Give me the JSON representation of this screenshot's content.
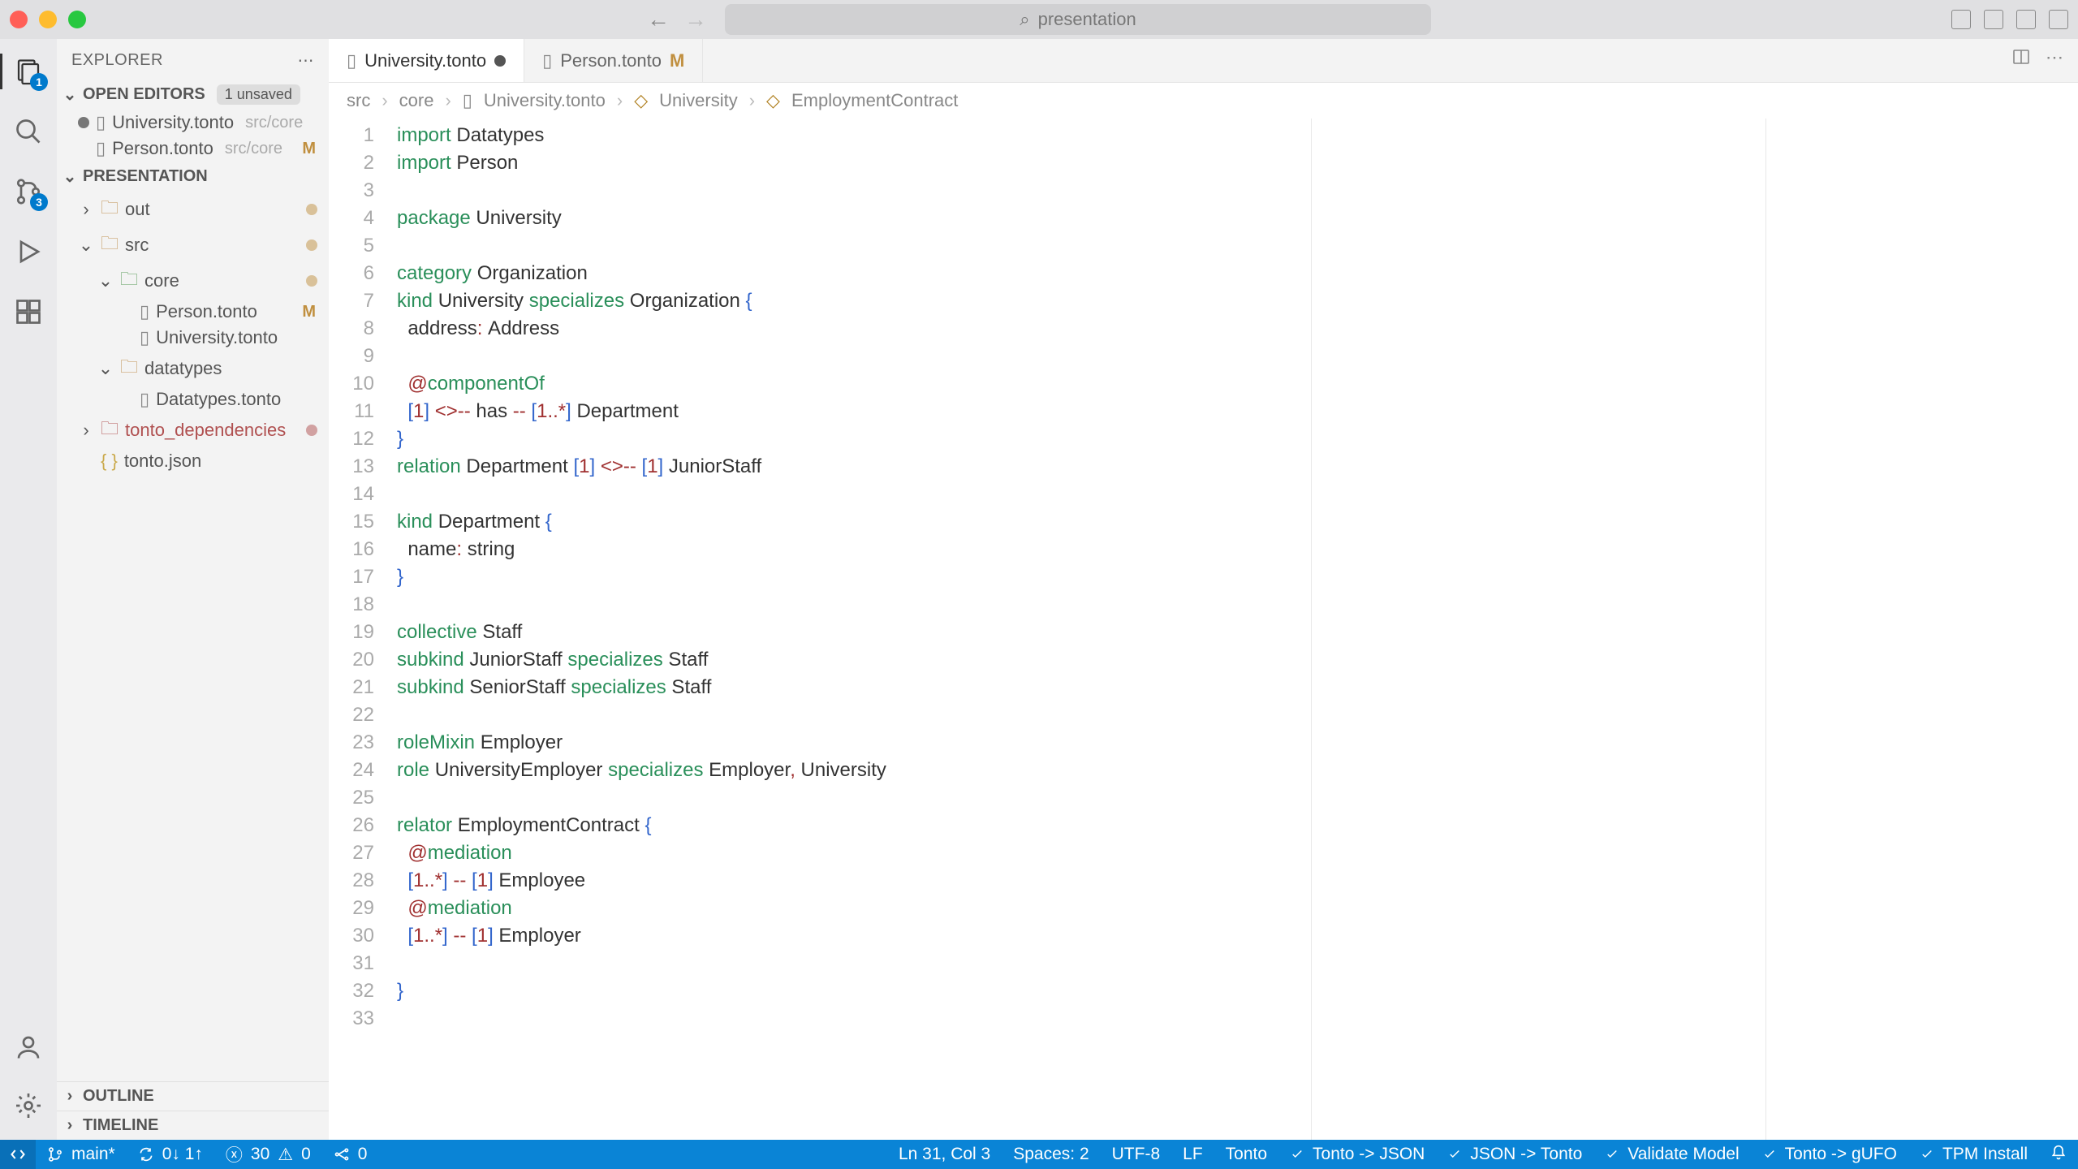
{
  "titlebar": {
    "search_placeholder": "presentation"
  },
  "sidebar": {
    "title": "EXPLORER",
    "open_editors": {
      "label": "OPEN EDITORS",
      "badge": "1 unsaved",
      "items": [
        {
          "name": "University.tonto",
          "meta": "src/core",
          "dirty": true
        },
        {
          "name": "Person.tonto",
          "meta": "src/core",
          "mtag": "M"
        }
      ]
    },
    "project": {
      "label": "PRESENTATION",
      "tree": [
        {
          "lvl": 1,
          "chev": ">",
          "icon": "folder",
          "name": "out",
          "dotcolor": "#c08f3f"
        },
        {
          "lvl": 1,
          "chev": "v",
          "icon": "folder",
          "name": "src",
          "dotcolor": "#c08f3f"
        },
        {
          "lvl": 2,
          "chev": "v",
          "icon": "folder",
          "color": "green",
          "name": "core",
          "dotcolor": "#c08f3f"
        },
        {
          "lvl": 3,
          "icon": "file",
          "name": "Person.tonto",
          "mtag": "M"
        },
        {
          "lvl": 3,
          "icon": "file",
          "name": "University.tonto"
        },
        {
          "lvl": 2,
          "chev": "v",
          "icon": "folder",
          "name": "datatypes"
        },
        {
          "lvl": 3,
          "icon": "file",
          "name": "Datatypes.tonto"
        },
        {
          "lvl": 1,
          "chev": ">",
          "icon": "folder",
          "color": "#b05050",
          "name": "tonto_dependencies",
          "namecolor": "#b05050",
          "dotcolor": "#b05050"
        },
        {
          "lvl": 1,
          "icon": "json",
          "name": "tonto.json"
        }
      ]
    },
    "outline": "OUTLINE",
    "timeline": "TIMELINE"
  },
  "tabs": [
    {
      "name": "University.tonto",
      "dirty": true,
      "active": true
    },
    {
      "name": "Person.tonto",
      "m": "M"
    }
  ],
  "breadcrumb": [
    "src",
    "core",
    "University.tonto",
    "University",
    "EmploymentContract"
  ],
  "activity_badges": {
    "explorer": "1",
    "scm": "3"
  },
  "code_lines": [
    {
      "n": 1,
      "seg": [
        [
          "kw",
          "import"
        ],
        [
          "",
          " Datatypes"
        ]
      ]
    },
    {
      "n": 2,
      "seg": [
        [
          "kw",
          "import"
        ],
        [
          "",
          " Person"
        ]
      ]
    },
    {
      "n": 3,
      "seg": [
        [
          "",
          ""
        ]
      ]
    },
    {
      "n": 4,
      "seg": [
        [
          "kw",
          "package"
        ],
        [
          "",
          " University"
        ]
      ]
    },
    {
      "n": 5,
      "seg": [
        [
          "",
          ""
        ]
      ]
    },
    {
      "n": 6,
      "seg": [
        [
          "kw",
          "category"
        ],
        [
          "",
          " Organization"
        ]
      ]
    },
    {
      "n": 7,
      "seg": [
        [
          "kw",
          "kind"
        ],
        [
          "",
          " University "
        ],
        [
          "kw",
          "specializes"
        ],
        [
          "",
          " Organization "
        ],
        [
          "br",
          "{"
        ]
      ]
    },
    {
      "n": 8,
      "seg": [
        [
          "",
          "  address"
        ],
        [
          "op",
          ":"
        ],
        [
          "",
          " Address"
        ]
      ]
    },
    {
      "n": 9,
      "seg": [
        [
          "",
          ""
        ]
      ]
    },
    {
      "n": 10,
      "seg": [
        [
          "",
          "  "
        ],
        [
          "op",
          "@"
        ],
        [
          "kw",
          "componentOf"
        ]
      ]
    },
    {
      "n": 11,
      "seg": [
        [
          "",
          "  "
        ],
        [
          "br",
          "["
        ],
        [
          "op",
          "1"
        ],
        [
          "br",
          "]"
        ],
        [
          "",
          " "
        ],
        [
          "op",
          "<>--"
        ],
        [
          "",
          " has "
        ],
        [
          "op",
          "--"
        ],
        [
          "",
          " "
        ],
        [
          "br",
          "["
        ],
        [
          "op",
          "1..*"
        ],
        [
          "br",
          "]"
        ],
        [
          "",
          " Department"
        ]
      ]
    },
    {
      "n": 12,
      "seg": [
        [
          "br",
          "}"
        ]
      ]
    },
    {
      "n": 13,
      "seg": [
        [
          "kw",
          "relation"
        ],
        [
          "",
          " Department "
        ],
        [
          "br",
          "["
        ],
        [
          "op",
          "1"
        ],
        [
          "br",
          "]"
        ],
        [
          "",
          " "
        ],
        [
          "op",
          "<>--"
        ],
        [
          "",
          " "
        ],
        [
          "br",
          "["
        ],
        [
          "op",
          "1"
        ],
        [
          "br",
          "]"
        ],
        [
          "",
          " JuniorStaff"
        ]
      ]
    },
    {
      "n": 14,
      "seg": [
        [
          "",
          ""
        ]
      ]
    },
    {
      "n": 15,
      "seg": [
        [
          "kw",
          "kind"
        ],
        [
          "",
          " Department "
        ],
        [
          "br",
          "{"
        ]
      ]
    },
    {
      "n": 16,
      "seg": [
        [
          "",
          "  name"
        ],
        [
          "op",
          ":"
        ],
        [
          "",
          " string"
        ]
      ]
    },
    {
      "n": 17,
      "seg": [
        [
          "br",
          "}"
        ]
      ]
    },
    {
      "n": 18,
      "seg": [
        [
          "",
          ""
        ]
      ]
    },
    {
      "n": 19,
      "seg": [
        [
          "kw",
          "collective"
        ],
        [
          "",
          " Staff"
        ]
      ]
    },
    {
      "n": 20,
      "seg": [
        [
          "kw",
          "subkind"
        ],
        [
          "",
          " JuniorStaff "
        ],
        [
          "kw",
          "specializes"
        ],
        [
          "",
          " Staff"
        ]
      ]
    },
    {
      "n": 21,
      "seg": [
        [
          "kw",
          "subkind"
        ],
        [
          "",
          " SeniorStaff "
        ],
        [
          "kw",
          "specializes"
        ],
        [
          "",
          " Staff"
        ]
      ]
    },
    {
      "n": 22,
      "seg": [
        [
          "",
          ""
        ]
      ]
    },
    {
      "n": 23,
      "seg": [
        [
          "kw",
          "roleMixin"
        ],
        [
          "",
          " Employer"
        ]
      ]
    },
    {
      "n": 24,
      "seg": [
        [
          "kw",
          "role"
        ],
        [
          "",
          " UniversityEmployer "
        ],
        [
          "kw",
          "specializes"
        ],
        [
          "",
          " Employer"
        ],
        [
          "op",
          ","
        ],
        [
          "",
          " University"
        ]
      ]
    },
    {
      "n": 25,
      "seg": [
        [
          "",
          ""
        ]
      ]
    },
    {
      "n": 26,
      "seg": [
        [
          "kw",
          "relator"
        ],
        [
          "",
          " EmploymentContract "
        ],
        [
          "br",
          "{"
        ]
      ]
    },
    {
      "n": 27,
      "seg": [
        [
          "",
          "  "
        ],
        [
          "op",
          "@"
        ],
        [
          "kw",
          "mediation"
        ]
      ]
    },
    {
      "n": 28,
      "seg": [
        [
          "",
          "  "
        ],
        [
          "br",
          "["
        ],
        [
          "op",
          "1..*"
        ],
        [
          "br",
          "]"
        ],
        [
          "",
          " "
        ],
        [
          "op",
          "--"
        ],
        [
          "",
          " "
        ],
        [
          "br",
          "["
        ],
        [
          "op",
          "1"
        ],
        [
          "br",
          "]"
        ],
        [
          "",
          " Employee"
        ]
      ]
    },
    {
      "n": 29,
      "seg": [
        [
          "",
          "  "
        ],
        [
          "op",
          "@"
        ],
        [
          "kw",
          "mediation"
        ]
      ]
    },
    {
      "n": 30,
      "seg": [
        [
          "",
          "  "
        ],
        [
          "br",
          "["
        ],
        [
          "op",
          "1..*"
        ],
        [
          "br",
          "]"
        ],
        [
          "",
          " "
        ],
        [
          "op",
          "--"
        ],
        [
          "",
          " "
        ],
        [
          "br",
          "["
        ],
        [
          "op",
          "1"
        ],
        [
          "br",
          "]"
        ],
        [
          "",
          " Employer"
        ]
      ]
    },
    {
      "n": 31,
      "seg": [
        [
          "",
          ""
        ]
      ]
    },
    {
      "n": 32,
      "seg": [
        [
          "br",
          "}"
        ]
      ]
    },
    {
      "n": 33,
      "seg": [
        [
          "",
          ""
        ]
      ]
    }
  ],
  "status": {
    "branch": "main*",
    "sync": "0↓ 1↑",
    "errors": "30",
    "warnings": "0",
    "ports": "0",
    "cursor": "Ln 31, Col 3",
    "spaces": "Spaces: 2",
    "enc": "UTF-8",
    "eol": "LF",
    "lang": "Tonto",
    "actions": [
      "Tonto -> JSON",
      "JSON -> Tonto",
      "Validate Model",
      "Tonto -> gUFO",
      "TPM Install"
    ]
  }
}
